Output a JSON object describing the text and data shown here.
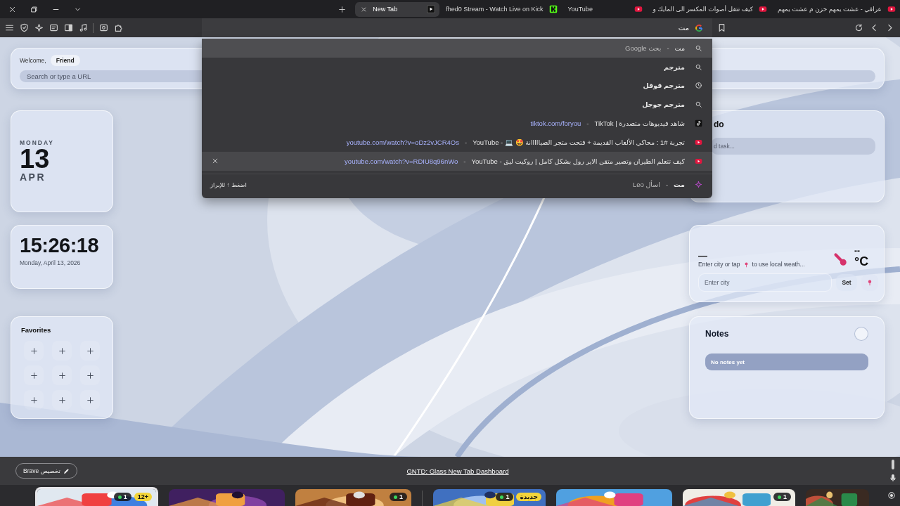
{
  "window_controls": [
    {
      "kind": "close"
    },
    {
      "kind": "restore"
    },
    {
      "kind": "minimize"
    },
    {
      "kind": "dropdown"
    }
  ],
  "tabs": [
    {
      "title": "عراقي - عشت يمهم حزن م عشت يمهم",
      "kind": "youtube",
      "selected": false
    },
    {
      "title": "كيف تتقل أصوات المكسر الى المايك و",
      "kind": "youtube",
      "selected": false
    },
    {
      "title": "YouTube",
      "kind": "youtube",
      "selected": false
    },
    {
      "title": "fhed0 Stream - Watch Live on Kick",
      "kind": "kick",
      "selected": false
    },
    {
      "title": "New Tab",
      "kind": "play",
      "selected": true
    }
  ],
  "toolbar": {
    "left_buttons": [
      {
        "kind": "menu"
      },
      {
        "kind": "shield"
      },
      {
        "kind": "sparkle"
      },
      {
        "kind": "reader"
      },
      {
        "kind": "sidebar"
      },
      {
        "kind": "music"
      },
      {
        "kind": "screenshot"
      },
      {
        "kind": "extensions"
      }
    ],
    "address": {
      "value": "مت"
    },
    "right_buttons": [
      {
        "kind": "reload"
      },
      {
        "kind": "back"
      },
      {
        "kind": "forward"
      }
    ]
  },
  "suggestions": {
    "separator": "-",
    "hint": "اضغط ↑ للإبراز",
    "rows": [
      {
        "kind": "search",
        "title": "مت",
        "detail": "بحث Google",
        "emphasis": false,
        "selected": true,
        "hovered": false
      },
      {
        "kind": "search",
        "title": "مترجم",
        "emphasis": true,
        "selected": false,
        "hovered": false
      },
      {
        "kind": "history",
        "title": "مترجم قوقل",
        "emphasis": true,
        "selected": false,
        "hovered": false
      },
      {
        "kind": "search",
        "title": "مترجم جوجل",
        "emphasis": true,
        "selected": false,
        "hovered": false
      },
      {
        "kind": "tiktok",
        "title": "شاهد فيديوهات متصدرة | TikTok",
        "url": "tiktok.com/foryou",
        "emphasis": false,
        "selected": false,
        "hovered": false
      },
      {
        "kind": "youtube",
        "title": "تجربة #1 : محاكي الألعاب القديمة + فتحت متجر الصيااااانة 🤩 💻 - YouTube",
        "url": "youtube.com/watch?v=oDz2vJCR4Os",
        "emphasis": false,
        "selected": false,
        "hovered": false
      },
      {
        "kind": "youtube",
        "title": "كيف تتعلم الطيران وتصير متقن الاير رول بشكل كامل | روكيت ليق - YouTube",
        "url": "youtube.com/watch?v=RDIU8q96nWo",
        "emphasis": false,
        "selected": false,
        "hovered": true
      },
      {
        "kind": "leo",
        "title": "مت",
        "detail": "اسأل Leo",
        "emphasis": true,
        "selected": false,
        "hovered": false
      }
    ]
  },
  "dashboard": {
    "greeting": {
      "label": "Welcome,",
      "name": "Friend",
      "search_placeholder": "Search or type a URL"
    },
    "date": {
      "weekday": "MONDAY",
      "day": "13",
      "month": "APR"
    },
    "clock": {
      "time": "15:26:18",
      "date": "Monday, April 13, 2026"
    },
    "favorites": {
      "title": "Favorites",
      "slots": [
        {
          "kind": "add"
        },
        {
          "kind": "add"
        },
        {
          "kind": "add"
        },
        {
          "kind": "add"
        },
        {
          "kind": "add"
        },
        {
          "kind": "add"
        },
        {
          "kind": "add"
        },
        {
          "kind": "add"
        },
        {
          "kind": "add"
        }
      ]
    },
    "todo": {
      "title": "do",
      "placeholder": "d task..."
    },
    "weather": {
      "condition": "—",
      "hint_before": "Enter city or tap",
      "hint_after": "to use local weath...",
      "temperature": "--",
      "unit": "°C",
      "city_placeholder": "Enter city",
      "set_button": "Set"
    },
    "notes": {
      "title": "Notes",
      "empty": "No notes yet"
    }
  },
  "footer": {
    "customize": "Brave تخصيص",
    "link": "GNTD: Glass New Tab Dashboard"
  },
  "games": [
    {
      "selected": false
    },
    {
      "selected": false,
      "badge": "1"
    },
    {
      "selected": false
    },
    {
      "selected": false,
      "badge": "1",
      "tag": "جديدة"
    },
    {
      "selected": false,
      "badge": "1"
    },
    {
      "selected": false
    },
    {
      "selected": true,
      "badge": "1",
      "tag": "12+"
    }
  ]
}
